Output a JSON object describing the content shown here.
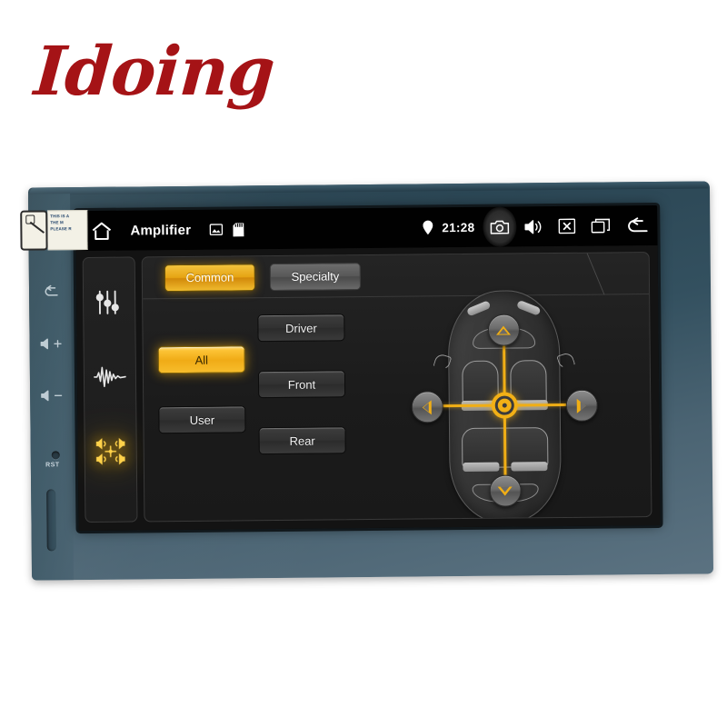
{
  "brand": {
    "logo_text": "Idoing"
  },
  "statusbar": {
    "home_icon": "home-icon",
    "title": "Amplifier",
    "left_icons": [
      {
        "name": "gallery-icon",
        "label": "Gallery"
      },
      {
        "name": "sd-card-icon",
        "label": "SD Card"
      }
    ],
    "location_icon": "location-pin-icon",
    "time": "21:28",
    "right_icons": [
      {
        "name": "camera-icon",
        "label": "Screenshot",
        "highlighted": true
      },
      {
        "name": "volume-icon",
        "label": "Volume",
        "highlighted": false
      },
      {
        "name": "close-box-icon",
        "label": "Close",
        "highlighted": false
      },
      {
        "name": "recent-apps-icon",
        "label": "Recent Apps",
        "highlighted": false
      },
      {
        "name": "back-arrow-icon",
        "label": "Back",
        "highlighted": false
      }
    ]
  },
  "sidebar": {
    "items": [
      {
        "name": "equalizer-icon",
        "label": "Equalizer",
        "active": false
      },
      {
        "name": "waveform-icon",
        "label": "Sound Field",
        "active": false
      },
      {
        "name": "balance-fader-icon",
        "label": "Balance / Fader",
        "active": true
      }
    ]
  },
  "tabs": [
    {
      "label": "Common",
      "active": true
    },
    {
      "label": "Specialty",
      "active": false
    }
  ],
  "preset_buttons": {
    "left_column": [
      {
        "label": "All",
        "active": true
      },
      {
        "label": "User",
        "active": false
      }
    ],
    "mid_column": [
      {
        "label": "Driver",
        "active": false
      },
      {
        "label": "Front",
        "active": false
      },
      {
        "label": "Rear",
        "active": false
      }
    ]
  },
  "balance_widget": {
    "name": "car-balance-pad",
    "arrows": [
      {
        "name": "arrow-up-button",
        "label": "Fade Front"
      },
      {
        "name": "arrow-down-button",
        "label": "Fade Rear"
      },
      {
        "name": "arrow-left-button",
        "label": "Balance Left"
      },
      {
        "name": "arrow-right-button",
        "label": "Balance Right"
      }
    ],
    "crosshair_position": "center"
  },
  "hardware": {
    "buttons": [
      {
        "name": "hw-back-button",
        "glyph": "↩"
      },
      {
        "name": "hw-volume-up-button",
        "glyph": "🔊+"
      },
      {
        "name": "hw-volume-down-button",
        "glyph": "🔊-"
      }
    ],
    "reset_label": "RST",
    "sticker": {
      "lines": [
        "THIS IS A",
        "THE M",
        "PLEASE R"
      ]
    }
  },
  "colors": {
    "accent_gold": "#f0ae15",
    "accent_gold_light": "#ffdf86",
    "brand_red": "#a51316",
    "bezel": "#33505f",
    "screen_bg": "#131313"
  }
}
